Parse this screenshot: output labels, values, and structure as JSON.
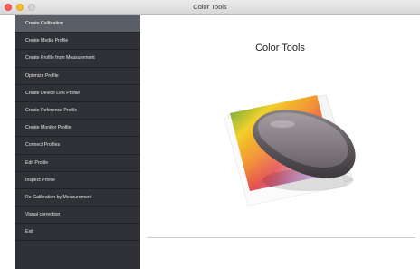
{
  "window": {
    "title": "Color Tools"
  },
  "sidebar": {
    "items": [
      {
        "label": "Create Calibration",
        "active": true
      },
      {
        "label": "Create Media Profile"
      },
      {
        "label": "Create Profile from Measurement"
      },
      {
        "label": "Optimize Profile"
      },
      {
        "label": "Create Device Link Profile"
      },
      {
        "label": "Create Reference Profile"
      },
      {
        "label": "Create Monitor Profile"
      },
      {
        "label": "Connect Profiles"
      },
      {
        "label": "Edit Profile"
      },
      {
        "label": "Inspect Profile"
      },
      {
        "label": "Re-Calibration by Measurement"
      },
      {
        "label": "Visual correction"
      },
      {
        "label": "Exit"
      }
    ]
  },
  "main": {
    "heading": "Color Tools"
  },
  "colors": {
    "sidebar_bg": "#2f3136",
    "active_item": "#5a5e66",
    "close": "#fc5f57",
    "minimize": "#fdbc2e"
  }
}
